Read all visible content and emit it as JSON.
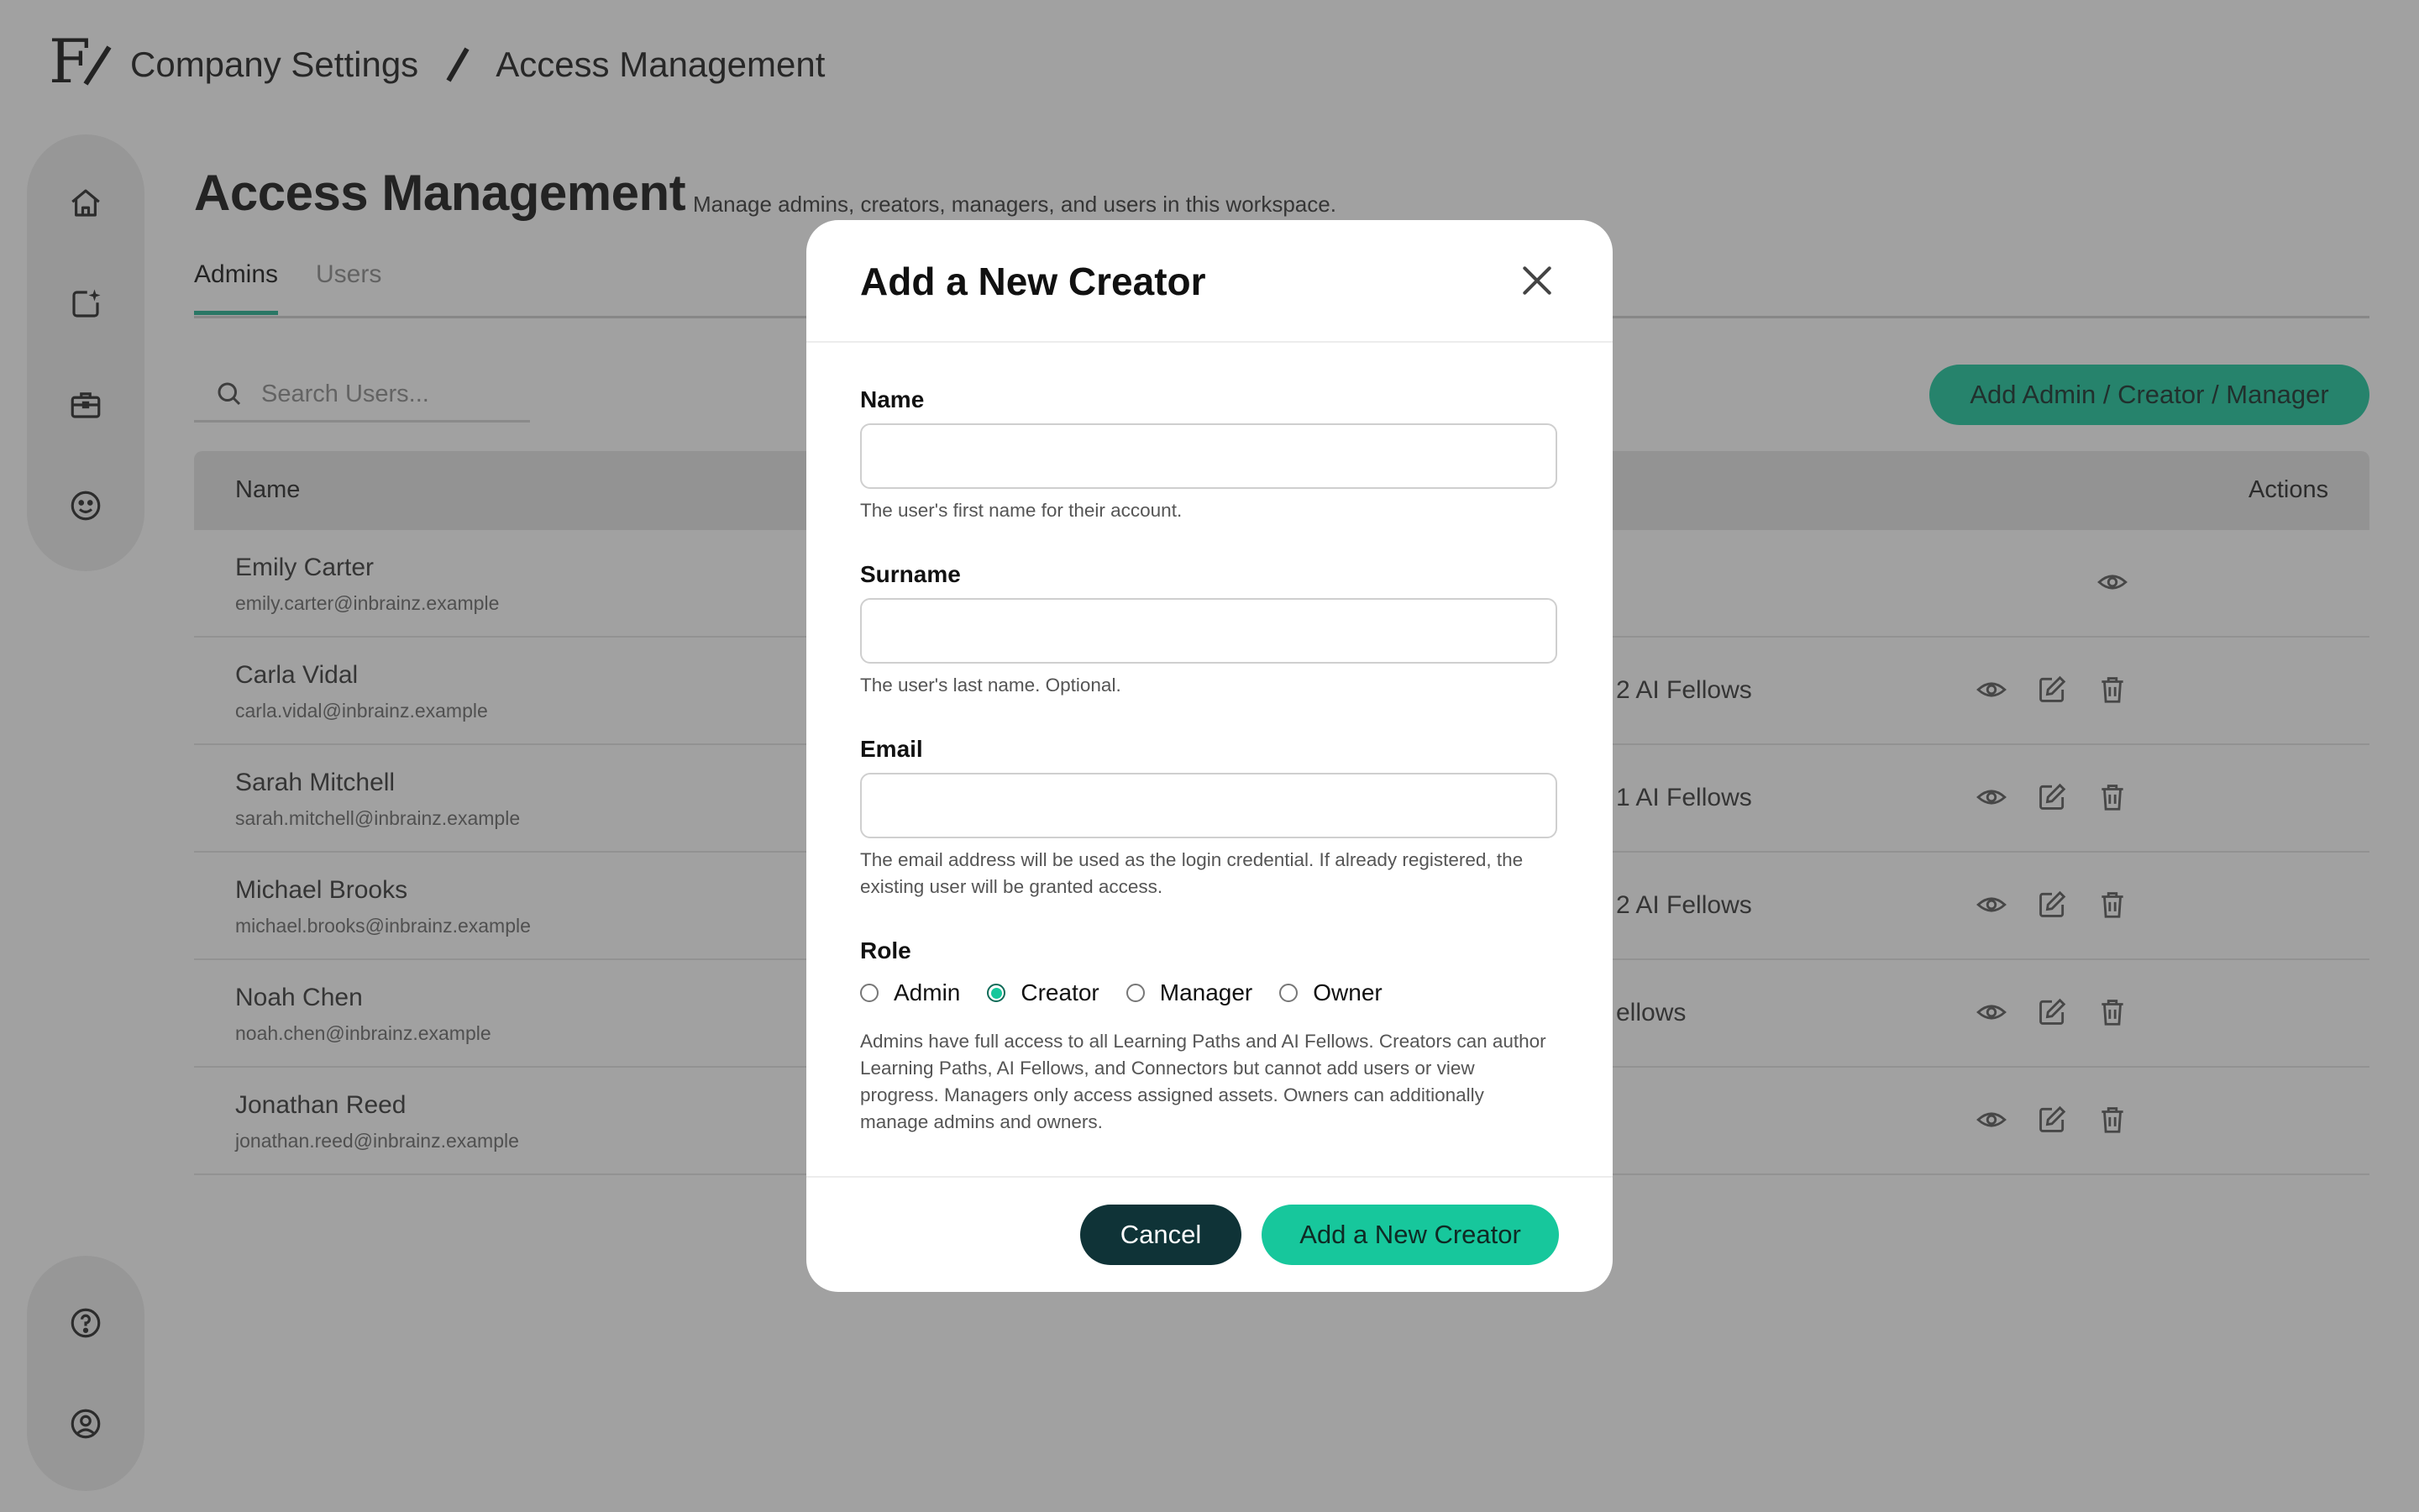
{
  "header": {
    "logo_text": "F/",
    "breadcrumb": [
      "Company Settings",
      "Access Management"
    ]
  },
  "sidebar": {
    "top_items": [
      {
        "icon": "home-icon"
      },
      {
        "icon": "new-content-sparkle-icon"
      },
      {
        "icon": "briefcase-icon"
      },
      {
        "icon": "smiley-icon"
      }
    ],
    "bottom_items": [
      {
        "icon": "help-icon"
      },
      {
        "icon": "user-profile-icon"
      }
    ]
  },
  "page": {
    "title": "Access Management",
    "subtitle": "Manage admins, creators, managers, and users in this workspace.",
    "tabs": [
      {
        "label": "Admins",
        "active": true
      },
      {
        "label": "Users",
        "active": false
      }
    ],
    "search_placeholder": "Search Users...",
    "add_button": "Add Admin / Creator / Manager"
  },
  "table": {
    "columns": [
      "Name",
      "Actions"
    ],
    "rows": [
      {
        "name": "Emily Carter",
        "email": "emily.carter@inbrainz.example",
        "extra": "",
        "actions": [
          "view"
        ]
      },
      {
        "name": "Carla Vidal",
        "email": "carla.vidal@inbrainz.example",
        "extra": "2 AI Fellows",
        "actions": [
          "view",
          "edit",
          "delete"
        ]
      },
      {
        "name": "Sarah Mitchell",
        "email": "sarah.mitchell@inbrainz.example",
        "extra": "1 AI Fellows",
        "actions": [
          "view",
          "edit",
          "delete"
        ]
      },
      {
        "name": "Michael Brooks",
        "email": "michael.brooks@inbrainz.example",
        "extra": "2 AI Fellows",
        "actions": [
          "view",
          "edit",
          "delete"
        ]
      },
      {
        "name": "Noah Chen",
        "email": "noah.chen@inbrainz.example",
        "extra": "ellows",
        "actions": [
          "view",
          "edit",
          "delete"
        ]
      },
      {
        "name": "Jonathan Reed",
        "email": "jonathan.reed@inbrainz.example",
        "extra": "",
        "actions": [
          "view",
          "edit",
          "delete"
        ]
      }
    ]
  },
  "modal": {
    "title": "Add a New Creator",
    "fields": {
      "name": {
        "label": "Name",
        "value": "",
        "help": "The user's first name for their account."
      },
      "surname": {
        "label": "Surname",
        "value": "",
        "help": "The user's last name. Optional."
      },
      "email": {
        "label": "Email",
        "value": "",
        "help": "The email address will be used as the login credential. If already registered, the existing user will be granted access."
      }
    },
    "role": {
      "label": "Role",
      "options": [
        "Admin",
        "Creator",
        "Manager",
        "Owner"
      ],
      "selected": "Creator",
      "help": "Admins have full access to all Learning Paths and AI Fellows. Creators can author Learning Paths, AI Fellows, and Connectors but cannot add users or view progress. Managers only access assigned assets. Owners can additionally manage admins and owners."
    },
    "cancel_label": "Cancel",
    "submit_label": "Add a New Creator"
  },
  "colors": {
    "accent": "#17c79c",
    "dark_button": "#0f3337",
    "overlay": "rgba(55,55,55,0.47)"
  }
}
